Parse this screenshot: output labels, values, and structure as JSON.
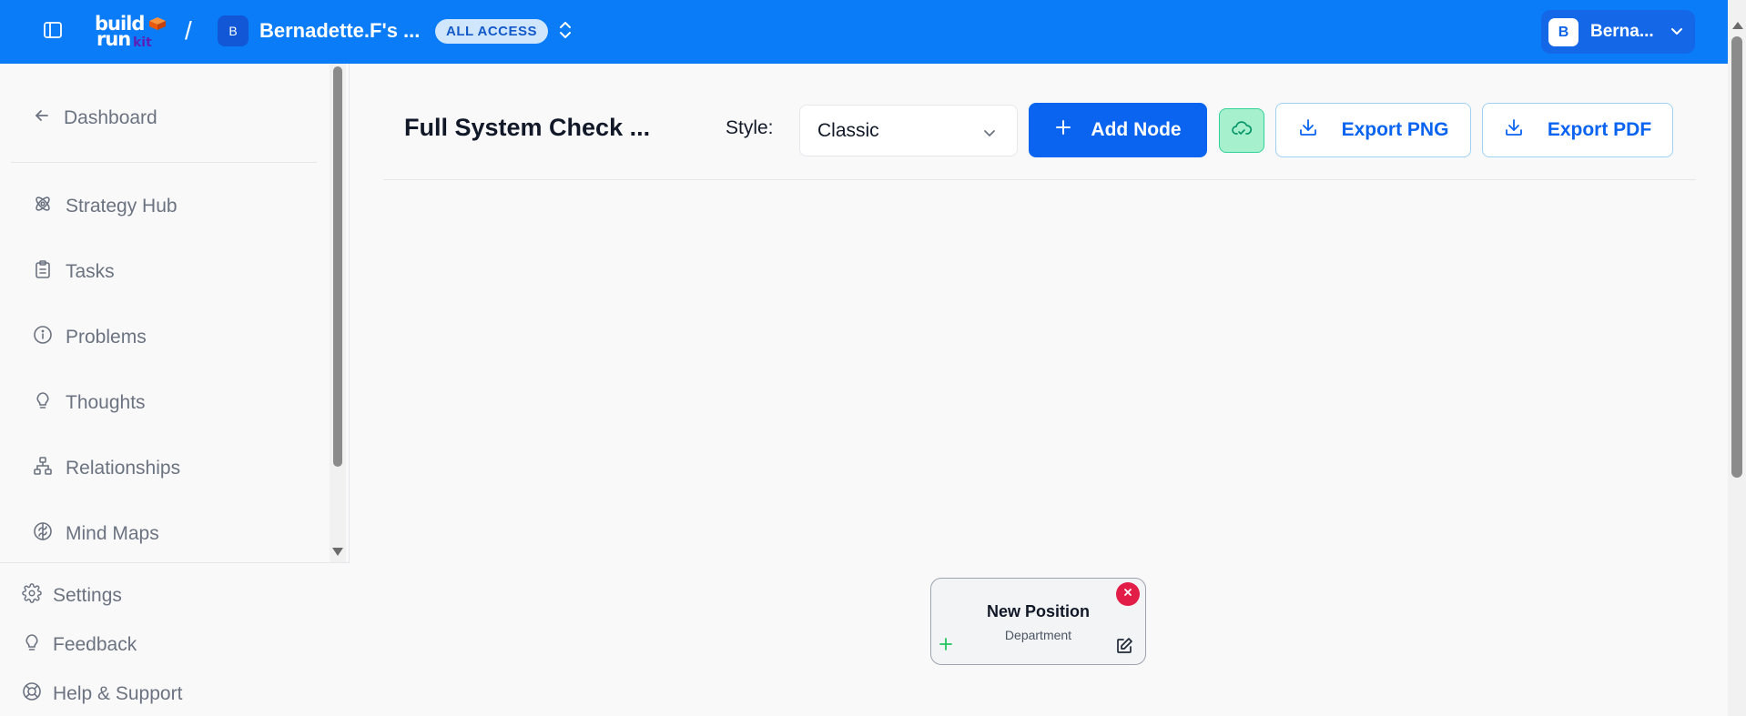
{
  "topbar": {
    "logo": {
      "line1": "build",
      "line2": "run",
      "line3": "kit"
    },
    "separator": "/",
    "workspace_initial": "B",
    "workspace_name": "Bernadette.F's ...",
    "access_badge": "ALL ACCESS",
    "user_initial": "B",
    "user_name": "Berna...",
    "bar_color": "#0a7cf8"
  },
  "sidebar": {
    "back_label": "Dashboard",
    "items": [
      {
        "label": "Strategy Hub",
        "icon": "atom-icon"
      },
      {
        "label": "Tasks",
        "icon": "clipboard-icon"
      },
      {
        "label": "Problems",
        "icon": "info-circle-icon"
      },
      {
        "label": "Thoughts",
        "icon": "lightbulb-icon"
      },
      {
        "label": "Relationships",
        "icon": "org-chart-icon"
      },
      {
        "label": "Mind Maps",
        "icon": "brain-icon"
      }
    ],
    "bottom": [
      {
        "label": "Settings",
        "icon": "gear-icon"
      },
      {
        "label": "Feedback",
        "icon": "lightbulb-icon"
      },
      {
        "label": "Help & Support",
        "icon": "lifebuoy-icon"
      }
    ]
  },
  "main": {
    "title": "Full System Check ...",
    "style_label": "Style:",
    "style_value": "Classic",
    "add_node_label": "Add Node",
    "export_png_label": "Export PNG",
    "export_pdf_label": "Export PDF",
    "accent_color": "#0a64ef",
    "sync_color": "#a7f0cd"
  },
  "canvas": {
    "nodes": [
      {
        "title": "New Position",
        "subtitle": "Department"
      }
    ]
  }
}
